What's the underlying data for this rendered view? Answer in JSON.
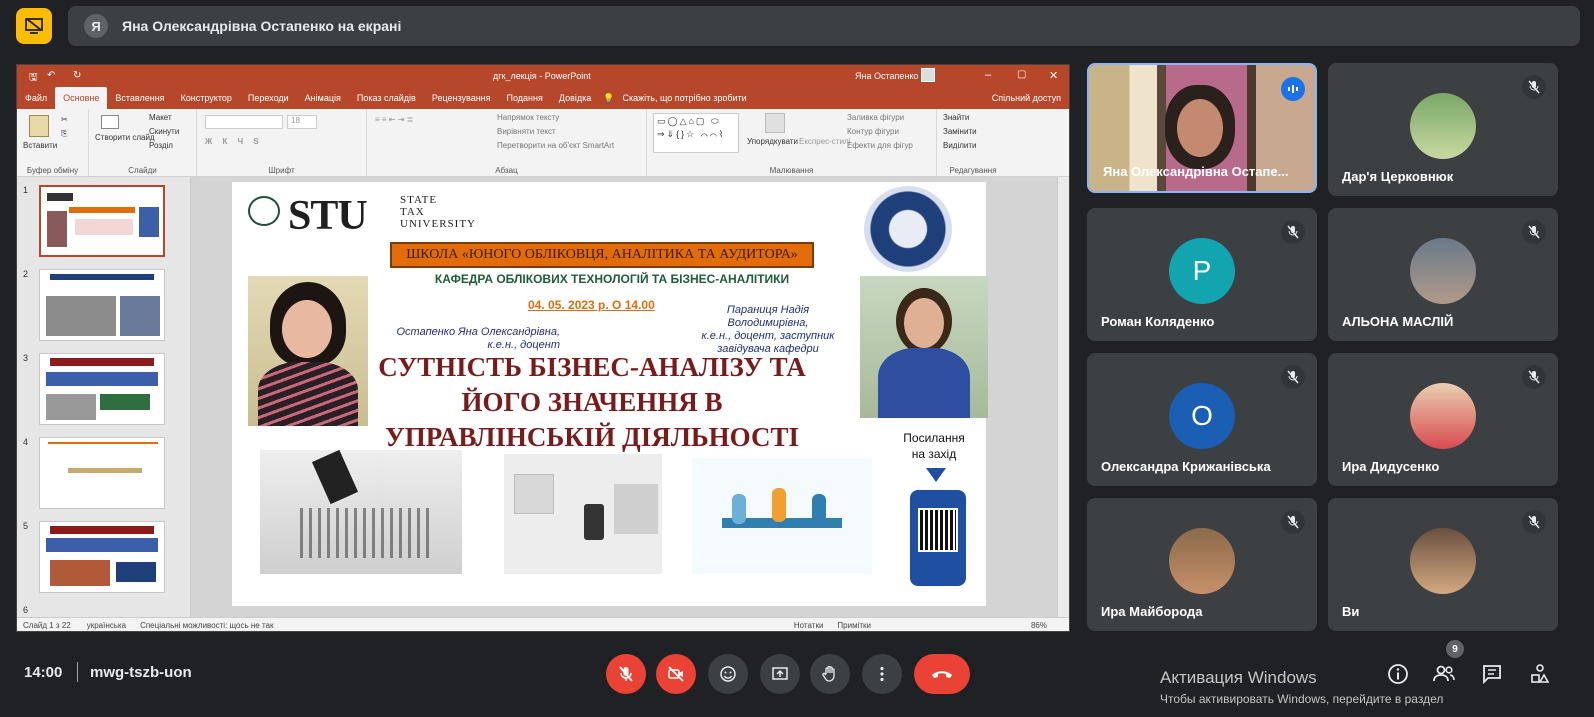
{
  "banner": {
    "avatar_letter": "Я",
    "text": "Яна Олександрівна Остапенко на екрані"
  },
  "ppt": {
    "title": "дгк_лекція  -  PowerPoint",
    "user": "Яна Остапенко",
    "tabs": [
      "Файл",
      "Основне",
      "Вставлення",
      "Конструктор",
      "Переходи",
      "Анімація",
      "Показ слайдів",
      "Рецензування",
      "Подання",
      "Довідка"
    ],
    "tell_me": "Скажіть, що потрібно зробити",
    "share": "Спільний доступ",
    "ribbon": {
      "paste": "Вставити",
      "clipboard": "Буфер обміну",
      "new_slide": "Створити слайд",
      "layout": "Макет",
      "reset": "Скинути",
      "section": "Розділ",
      "slides": "Слайди",
      "font_size": "18",
      "font": "Шрифт",
      "text_direction": "Напрямок тексту",
      "align_text": "Вирівняти текст",
      "smartart": "Перетворити на об'єкт SmartArt",
      "paragraph": "Абзац",
      "arrange": "Упорядкувати",
      "quick_styles": "Експрес-стилі",
      "shape_fill": "Заливка фігури",
      "shape_outline": "Контур фігури",
      "shape_effects": "Ефекти для фігур",
      "drawing": "Малювання",
      "find": "Знайти",
      "replace": "Замінити",
      "select": "Виділити",
      "editing": "Редагування"
    },
    "thumb_numbers": [
      "1",
      "2",
      "3",
      "4",
      "5",
      "6"
    ],
    "status": {
      "slide": "Слайд 1 з 22",
      "lang": "українська",
      "accessibility": "Спеціальні можливості: щось не так",
      "notes": "Нотатки",
      "comments": "Примітки",
      "zoom": "86%"
    }
  },
  "slide": {
    "logo": "STU",
    "logo_sub": [
      "STATE",
      "TAX",
      "UNIVERSITY"
    ],
    "school": "ШКОЛА «ЮНОГО ОБЛІКОВЦЯ, АНАЛІТИКА ТА АУДИТОРА»",
    "department": "КАФЕДРА ОБЛІКОВИХ ТЕХНОЛОГІЙ ТА БІЗНЕС-АНАЛІТИКИ",
    "date": "04. 05. 2023 р. О 14.00",
    "person1": [
      "Остапенко Яна Олександрівна,",
      "к.е.н., доцент"
    ],
    "person2": [
      "Параниця Надія",
      "Володимирівна,",
      "к.е.н., доцент, заступник",
      "завідувача кафедри"
    ],
    "title": [
      "СУТНІСТЬ БІЗНЕС-АНАЛІЗУ ТА",
      "ЙОГО ЗНАЧЕННЯ В",
      "УПРАВЛІНСЬКІЙ ДІЯЛЬНОСТІ"
    ],
    "link_label": [
      "Посилання",
      "на захід"
    ]
  },
  "participants": [
    {
      "name": "Яна Олександрівна Остапе...",
      "speaking": true
    },
    {
      "name": "Дар'я Церковнюк",
      "muted": true
    },
    {
      "name": "Роман Коляденко",
      "letter": "P",
      "color": "#12a4af",
      "muted": true
    },
    {
      "name": "АЛЬОНА МАСЛІЙ",
      "muted": true
    },
    {
      "name": "Олександра Крижанівська",
      "letter": "O",
      "color": "#1a5fb4",
      "muted": true
    },
    {
      "name": "Ира Дидусенко",
      "muted": true
    },
    {
      "name": "Ира Майборода",
      "muted": true
    },
    {
      "name": "Ви",
      "muted": true
    }
  ],
  "bottom": {
    "time": "14:00",
    "meeting_code": "mwg-tszb-uon",
    "people_count": "9"
  },
  "activation": {
    "title": "Активация Windows",
    "subtitle": "Чтобы активировать Windows, перейдите в раздел"
  },
  "colors": {
    "background": "#202124",
    "tile": "#3c4043",
    "accent_red": "#ea4335",
    "present_yellow": "#fbbc04",
    "ppt_brand": "#b7472a"
  }
}
